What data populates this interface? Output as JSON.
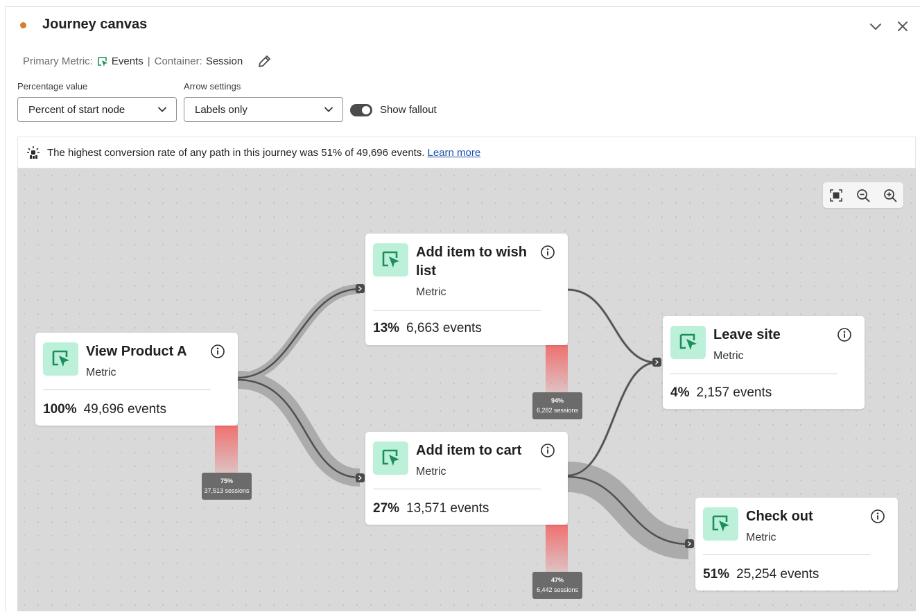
{
  "header": {
    "title": "Journey canvas",
    "status_color": "#d4802a"
  },
  "metric_info": {
    "primary_label": "Primary Metric:",
    "primary_value": "Events",
    "container_label": "Container:",
    "container_value": "Session",
    "separator": "|"
  },
  "controls": {
    "percentage_label": "Percentage value",
    "percentage_value": "Percent of start node",
    "arrow_label": "Arrow settings",
    "arrow_value": "Labels only",
    "fallout_label": "Show fallout",
    "fallout_on": true
  },
  "insight": {
    "text": "The highest conversion rate of any path in this journey was 51% of 49,696 events.",
    "link": "Learn more"
  },
  "nodes": [
    {
      "title_lines": [
        "View Product A"
      ],
      "subtitle": "Metric",
      "percent": "100%",
      "count": "49,696 events"
    },
    {
      "title_lines": [
        "Add item to wish",
        "list"
      ],
      "subtitle": "Metric",
      "percent": "13%",
      "count": "6,663 events"
    },
    {
      "title_lines": [
        "Add item to cart"
      ],
      "subtitle": "Metric",
      "percent": "27%",
      "count": "13,571 events"
    },
    {
      "title_lines": [
        "Leave site"
      ],
      "subtitle": "Metric",
      "percent": "4%",
      "count": "2,157 events"
    },
    {
      "title_lines": [
        "Check out"
      ],
      "subtitle": "Metric",
      "percent": "51%",
      "count": "25,254 events"
    }
  ],
  "fallouts": [
    {
      "percent": "75%",
      "sessions": "37,513 sessions"
    },
    {
      "percent": "94%",
      "sessions": "6,282 sessions"
    },
    {
      "percent": "47%",
      "sessions": "6,442 sessions"
    }
  ],
  "colors": {
    "node_icon_bg": "#bdf0d8",
    "node_icon_fg": "#1a8f5a",
    "fallout_red": "#f07070",
    "canvas_bg": "#d9d9d9"
  }
}
